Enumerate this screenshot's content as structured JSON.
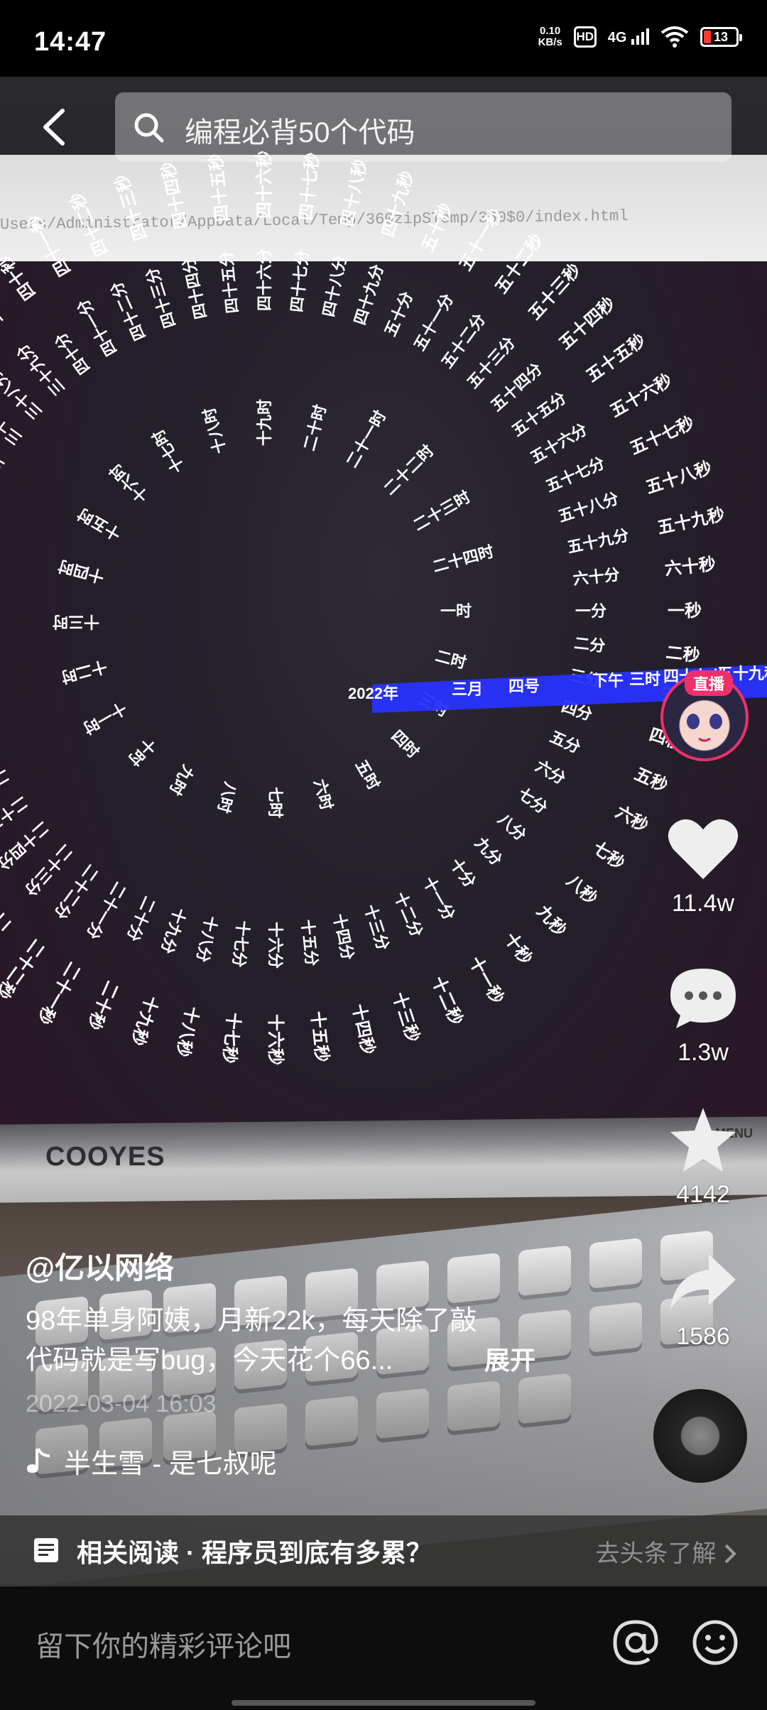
{
  "status_bar": {
    "time": "14:47",
    "net_speed_value": "0.10",
    "net_speed_unit": "KB/s",
    "hd_label": "HD",
    "network_type": "4G",
    "battery_level": "13"
  },
  "top": {
    "search_text": "编程必背50个代码",
    "url_text": "Users/Administrator/AppData/Local/Temp/360zipSTemp/360$0/index.html"
  },
  "video": {
    "monitor_brand": "COOYES",
    "monitor_menu": "MENU",
    "clock_center": {
      "year": "2022年",
      "month": "三月",
      "day": "四号",
      "ampm": "下午",
      "hour": "三时",
      "minute": "四十七分",
      "second": "五十九秒"
    }
  },
  "sidebar": {
    "live_badge": "直播",
    "likes": "11.4w",
    "comments": "1.3w",
    "favorites": "4142",
    "shares": "1586"
  },
  "caption": {
    "author": "@亿以网络",
    "description_line1": "98年单身阿姨，月新22k，每天除了敲",
    "description_line2": "代码就是写bug，今天花个66...",
    "expand_label": "展开",
    "timestamp": "2022-03-04 16:03",
    "music": "半生雪 - 是七叔呢"
  },
  "related": {
    "title": "相关阅读 · 程序员到底有多累？",
    "link": "去头条了解"
  },
  "comment_bar": {
    "placeholder": "留下你的精彩评论吧"
  },
  "colors": {
    "live_pink": "#f0306a",
    "highlight_blue": "#2832ff",
    "clock_text": "#ffffff"
  }
}
